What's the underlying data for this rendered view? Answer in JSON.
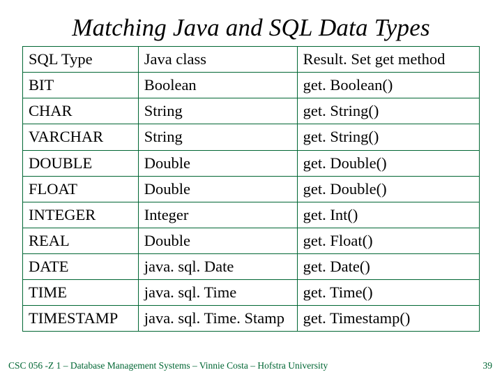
{
  "title": "Matching Java and SQL Data Types",
  "headers": {
    "c1": "SQL Type",
    "c2": "Java class",
    "c3": "Result. Set get method"
  },
  "rows": [
    {
      "c1": "BIT",
      "c2": "Boolean",
      "c3": "get. Boolean()"
    },
    {
      "c1": "CHAR",
      "c2": "String",
      "c3": "get. String()"
    },
    {
      "c1": "VARCHAR",
      "c2": "String",
      "c3": "get. String()"
    },
    {
      "c1": "DOUBLE",
      "c2": "Double",
      "c3": "get. Double()"
    },
    {
      "c1": "FLOAT",
      "c2": "Double",
      "c3": "get. Double()"
    },
    {
      "c1": "INTEGER",
      "c2": "Integer",
      "c3": "get. Int()"
    },
    {
      "c1": "REAL",
      "c2": "Double",
      "c3": "get. Float()"
    },
    {
      "c1": "DATE",
      "c2": "java. sql. Date",
      "c3": "get. Date()"
    },
    {
      "c1": "TIME",
      "c2": "java. sql. Time",
      "c3": "get. Time()"
    },
    {
      "c1": "TIMESTAMP",
      "c2": "java. sql. Time. Stamp",
      "c3": "get. Timestamp()"
    }
  ],
  "footer": "CSC 056 -Z 1 – Database Management Systems – Vinnie Costa – Hofstra University",
  "page": "39"
}
